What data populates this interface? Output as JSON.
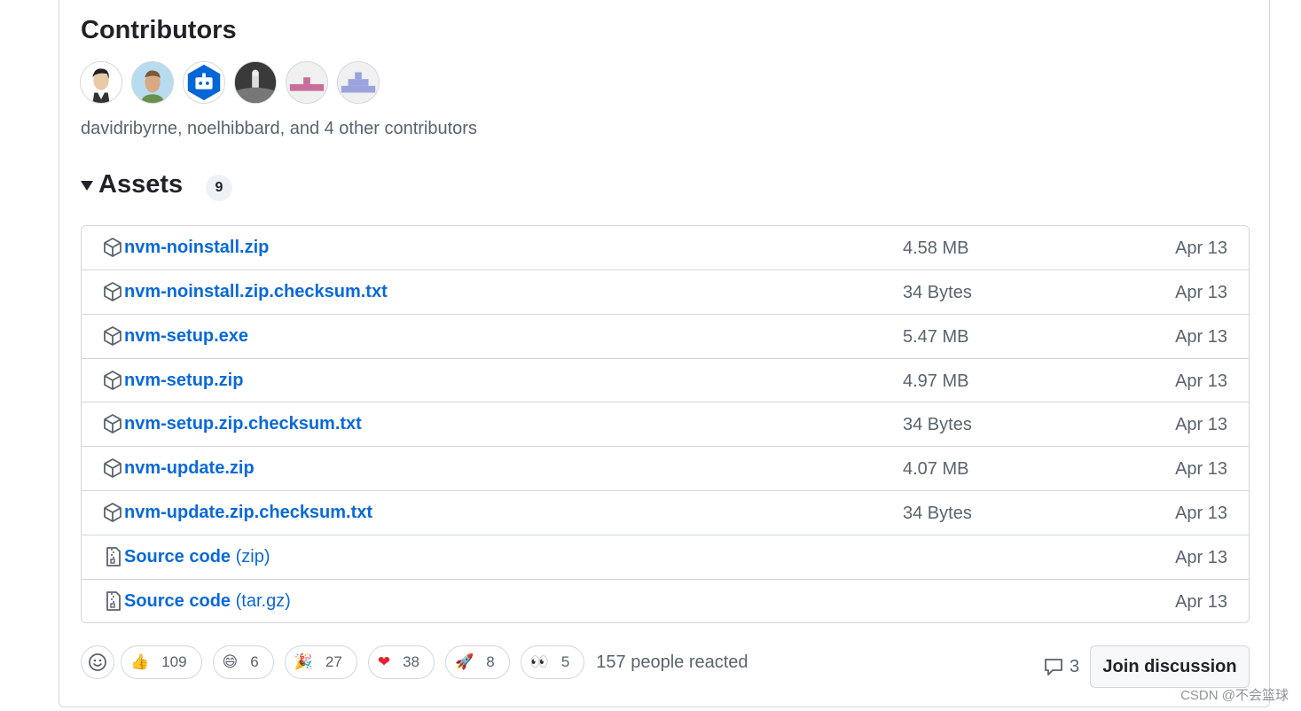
{
  "contributors": {
    "title": "Contributors",
    "summary": "davidribyrne, noelhibbard, and 4 other contributors"
  },
  "assets": {
    "title": "Assets",
    "count": "9",
    "items": [
      {
        "name": "nvm-noinstall.zip",
        "ext": "",
        "size": "4.58 MB",
        "date": "Apr 13",
        "icon": "package-icon"
      },
      {
        "name": "nvm-noinstall.zip.checksum.txt",
        "ext": "",
        "size": "34 Bytes",
        "date": "Apr 13",
        "icon": "package-icon"
      },
      {
        "name": "nvm-setup.exe",
        "ext": "",
        "size": "5.47 MB",
        "date": "Apr 13",
        "icon": "package-icon"
      },
      {
        "name": "nvm-setup.zip",
        "ext": "",
        "size": "4.97 MB",
        "date": "Apr 13",
        "icon": "package-icon"
      },
      {
        "name": "nvm-setup.zip.checksum.txt",
        "ext": "",
        "size": "34 Bytes",
        "date": "Apr 13",
        "icon": "package-icon"
      },
      {
        "name": "nvm-update.zip",
        "ext": "",
        "size": "4.07 MB",
        "date": "Apr 13",
        "icon": "package-icon"
      },
      {
        "name": "nvm-update.zip.checksum.txt",
        "ext": "",
        "size": "34 Bytes",
        "date": "Apr 13",
        "icon": "package-icon"
      },
      {
        "name": "Source code",
        "ext": "(zip)",
        "size": "",
        "date": "Apr 13",
        "icon": "file-zip-icon"
      },
      {
        "name": "Source code",
        "ext": "(tar.gz)",
        "size": "",
        "date": "Apr 13",
        "icon": "file-zip-icon"
      }
    ]
  },
  "reactions": {
    "items": [
      {
        "emoji": "👍",
        "count": "109"
      },
      {
        "emoji": "😄",
        "count": "6"
      },
      {
        "emoji": "🎉",
        "count": "27"
      },
      {
        "emoji": "❤",
        "count": "38"
      },
      {
        "emoji": "🚀",
        "count": "8"
      },
      {
        "emoji": "👀",
        "count": "5"
      }
    ],
    "summary": "157 people reacted"
  },
  "discussion": {
    "comment_count": "3",
    "join_label": "Join discussion"
  },
  "watermark": "CSDN @不会篮球"
}
